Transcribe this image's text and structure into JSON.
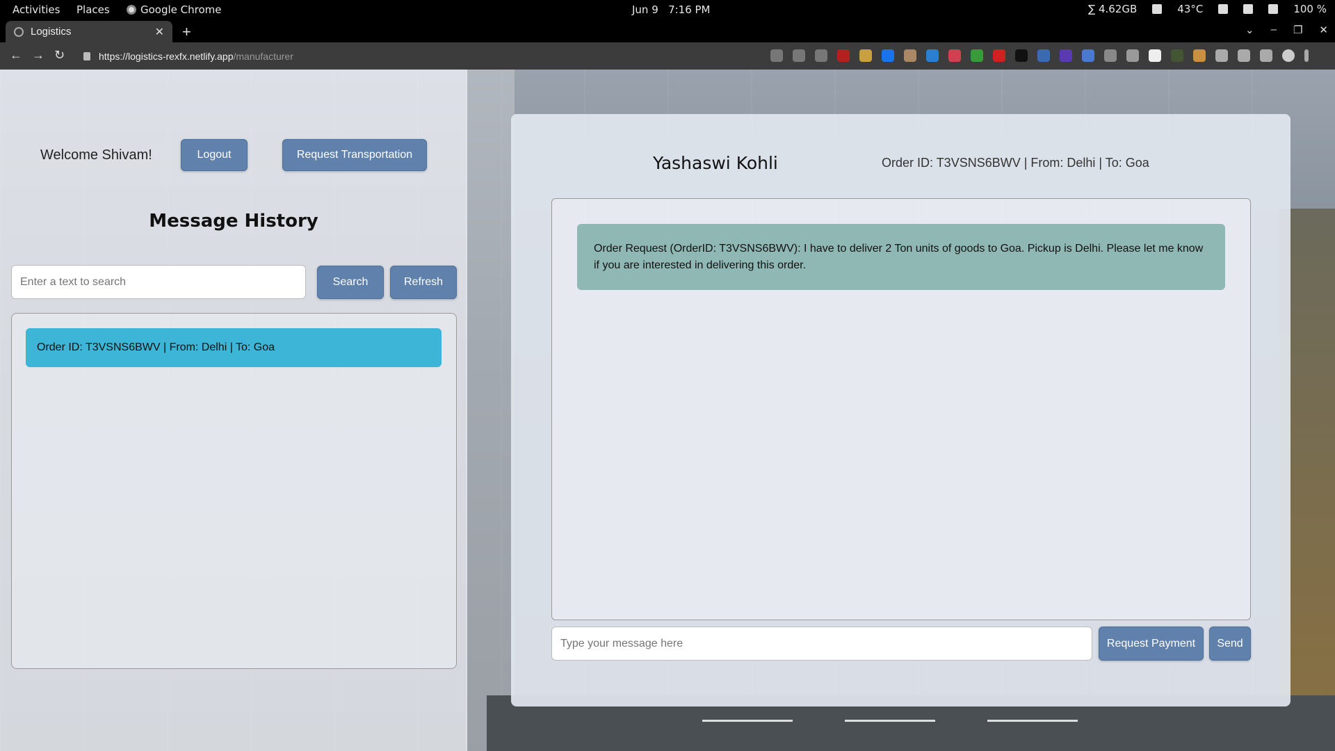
{
  "os_bar": {
    "activities": "Activities",
    "places": "Places",
    "app_name": "Google Chrome",
    "date": "Jun 9",
    "time": "7:16 PM",
    "memory": "∑ 4.62GB",
    "temperature": "43°C",
    "battery": "100 %"
  },
  "browser": {
    "tab_title": "Logistics",
    "url_host": "https://logistics-rexfx.netlify.app",
    "url_path": "/manufacturer"
  },
  "left": {
    "welcome": "Welcome Shivam!",
    "logout_label": "Logout",
    "request_transport_label": "Request Transportation",
    "history_title": "Message History",
    "search_placeholder": "Enter a text to search",
    "search_label": "Search",
    "refresh_label": "Refresh",
    "history_items": [
      {
        "label": "Order ID: T3VSNS6BWV | From: Delhi | To: Goa"
      }
    ]
  },
  "chat": {
    "contact_name": "Yashaswi Kohli",
    "order_info": "Order ID: T3VSNS6BWV | From: Delhi | To: Goa",
    "messages": [
      {
        "text": "Order Request (OrderID: T3VSNS6BWV): I have to deliver 2 Ton units of goods to Goa. Pickup is Delhi. Please let me know if you are interested in delivering this order."
      }
    ],
    "input_placeholder": "Type your message here",
    "request_payment_label": "Request Payment",
    "send_label": "Send"
  },
  "colors": {
    "button": "#5f81ab",
    "history_item": "#3db5d6",
    "bubble": "#8fb8b5"
  }
}
